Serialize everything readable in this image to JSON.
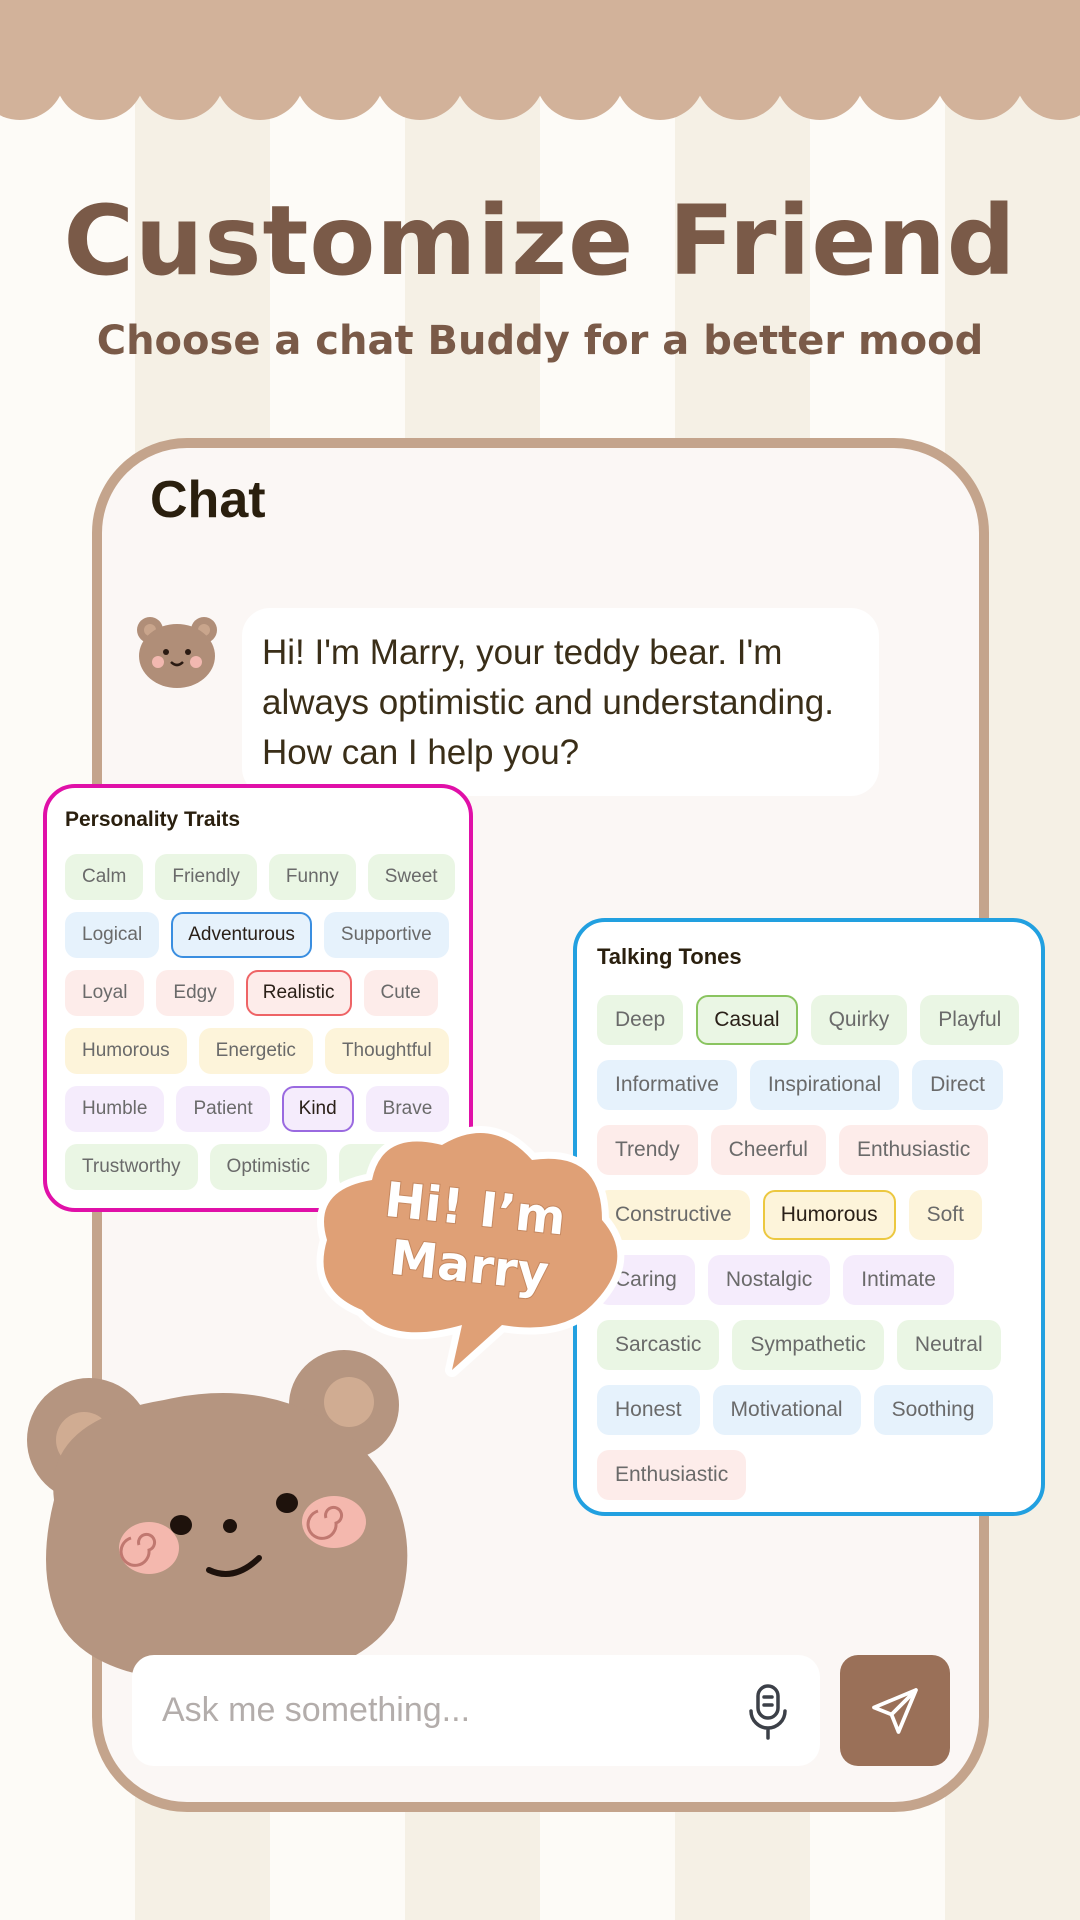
{
  "header": {
    "title": "Customize Friend",
    "subtitle": "Choose a chat Buddy for a better mood"
  },
  "chat": {
    "title": "Chat",
    "message": "Hi! I'm Marry, your teddy bear. I'm always optimistic and understanding. How can I help you?",
    "input_placeholder": "Ask me something...",
    "speech_line1": "Hi! I’m",
    "speech_line2": "Marry"
  },
  "colors": {
    "accent": "#9a7058",
    "frame": "#c4a48c",
    "title": "#7a5a48",
    "personality_border": "#e010a8",
    "tones_border": "#22a0e0",
    "speech": "#dfa076",
    "bg": {
      "green": "#eaf6e4",
      "blue": "#e6f2fc",
      "pink": "#fdecea",
      "yellow": "#fdf4da",
      "purple": "#f5ecfc"
    },
    "sel": {
      "green": "#8ac460",
      "blue": "#3a8ee0",
      "pink": "#ee6466",
      "yellow": "#ecc840",
      "purple": "#9a6ae0"
    }
  },
  "personality": {
    "title": "Personality Traits",
    "rows": [
      {
        "color": "green",
        "items": [
          {
            "label": "Calm"
          },
          {
            "label": "Friendly"
          },
          {
            "label": "Funny"
          },
          {
            "label": "Sweet"
          }
        ]
      },
      {
        "color": "blue",
        "items": [
          {
            "label": "Logical"
          },
          {
            "label": "Adventurous",
            "selected": true
          },
          {
            "label": "Supportive"
          }
        ]
      },
      {
        "color": "pink",
        "items": [
          {
            "label": "Loyal"
          },
          {
            "label": "Edgy"
          },
          {
            "label": "Realistic",
            "selected": true
          },
          {
            "label": "Cute"
          }
        ]
      },
      {
        "color": "yellow",
        "items": [
          {
            "label": "Humorous"
          },
          {
            "label": "Energetic"
          },
          {
            "label": "Thoughtful"
          }
        ]
      },
      {
        "color": "purple",
        "items": [
          {
            "label": "Humble"
          },
          {
            "label": "Patient"
          },
          {
            "label": "Kind",
            "selected": true
          },
          {
            "label": "Brave"
          }
        ]
      },
      {
        "color": "green",
        "items": [
          {
            "label": "Trustworthy"
          },
          {
            "label": "Optimistic"
          },
          {
            "label": ""
          }
        ]
      }
    ]
  },
  "tones": {
    "title": "Talking Tones",
    "rows": [
      {
        "color": "green",
        "items": [
          {
            "label": "Deep"
          },
          {
            "label": "Casual",
            "selected": true
          },
          {
            "label": "Quirky"
          },
          {
            "label": "Playful"
          }
        ]
      },
      {
        "color": "blue",
        "items": [
          {
            "label": "Informative"
          },
          {
            "label": "Inspirational"
          },
          {
            "label": "Direct"
          }
        ]
      },
      {
        "color": "pink",
        "items": [
          {
            "label": "Trendy"
          },
          {
            "label": "Cheerful"
          },
          {
            "label": "Enthusiastic"
          }
        ]
      },
      {
        "color": "yellow",
        "items": [
          {
            "label": "Constructive"
          },
          {
            "label": "Humorous",
            "selected": true
          },
          {
            "label": "Soft"
          }
        ]
      },
      {
        "color": "purple",
        "items": [
          {
            "label": "Caring"
          },
          {
            "label": "Nostalgic"
          },
          {
            "label": "Intimate"
          }
        ]
      },
      {
        "color": "green",
        "items": [
          {
            "label": "Sarcastic"
          },
          {
            "label": "Sympathetic"
          },
          {
            "label": "Neutral"
          }
        ]
      },
      {
        "color": "blue",
        "items": [
          {
            "label": "Honest"
          },
          {
            "label": "Motivational"
          },
          {
            "label": "Soothing"
          }
        ]
      },
      {
        "color": "pink",
        "items": [
          {
            "label": "Enthusiastic"
          }
        ]
      }
    ]
  },
  "icons": {
    "mic": "microphone-icon",
    "send": "send-icon"
  }
}
